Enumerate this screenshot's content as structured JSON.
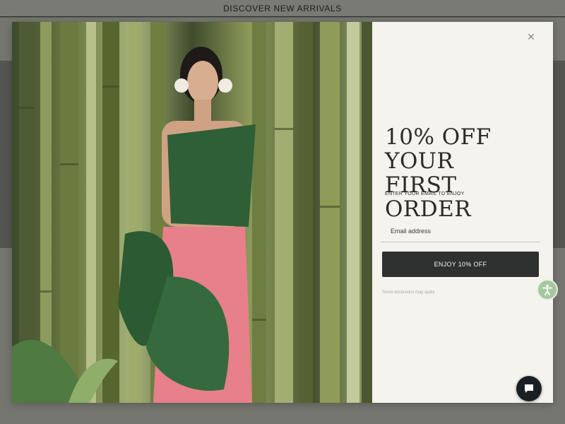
{
  "announcement": {
    "text": "DISCOVER NEW ARRIVALS"
  },
  "modal": {
    "headline_line1": "10% OFF YOUR",
    "headline_line2": "FIRST ORDER",
    "subtext": "ENTER YOUR EMAIL TO ENJOY",
    "email_placeholder": "Email address",
    "cta_label": "ENJOY 10% OFF",
    "fine_print": "Some exclusions may apply",
    "close_icon": "close-icon",
    "image_icon": "hero-photo"
  },
  "widgets": {
    "accessibility_icon": "accessibility-icon",
    "chat_icon": "chat-icon"
  },
  "colors": {
    "cta_bg": "#2f3030",
    "panel_bg": "#f5f3ee",
    "a11y_bg": "#a6c8a0",
    "chat_bg": "#1b1f24"
  }
}
